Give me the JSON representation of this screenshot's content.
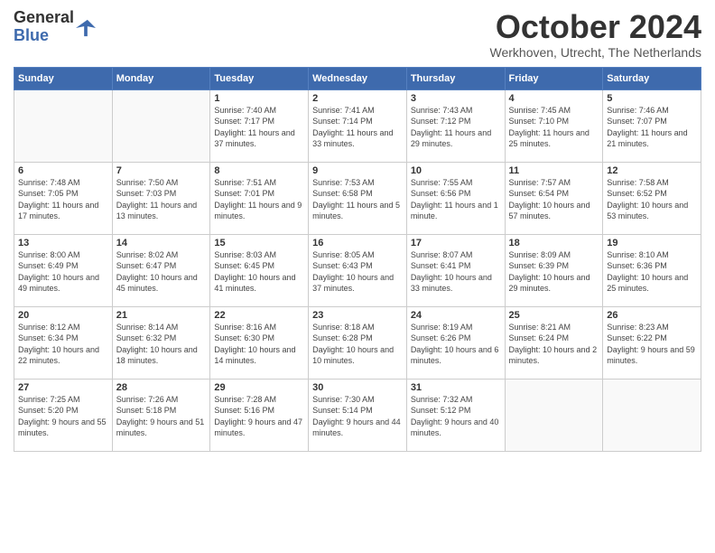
{
  "header": {
    "logo_line1": "General",
    "logo_line2": "Blue",
    "month": "October 2024",
    "location": "Werkhoven, Utrecht, The Netherlands"
  },
  "days_of_week": [
    "Sunday",
    "Monday",
    "Tuesday",
    "Wednesday",
    "Thursday",
    "Friday",
    "Saturday"
  ],
  "weeks": [
    [
      {
        "day": "",
        "sunrise": "",
        "sunset": "",
        "daylight": ""
      },
      {
        "day": "",
        "sunrise": "",
        "sunset": "",
        "daylight": ""
      },
      {
        "day": "1",
        "sunrise": "Sunrise: 7:40 AM",
        "sunset": "Sunset: 7:17 PM",
        "daylight": "Daylight: 11 hours and 37 minutes."
      },
      {
        "day": "2",
        "sunrise": "Sunrise: 7:41 AM",
        "sunset": "Sunset: 7:14 PM",
        "daylight": "Daylight: 11 hours and 33 minutes."
      },
      {
        "day": "3",
        "sunrise": "Sunrise: 7:43 AM",
        "sunset": "Sunset: 7:12 PM",
        "daylight": "Daylight: 11 hours and 29 minutes."
      },
      {
        "day": "4",
        "sunrise": "Sunrise: 7:45 AM",
        "sunset": "Sunset: 7:10 PM",
        "daylight": "Daylight: 11 hours and 25 minutes."
      },
      {
        "day": "5",
        "sunrise": "Sunrise: 7:46 AM",
        "sunset": "Sunset: 7:07 PM",
        "daylight": "Daylight: 11 hours and 21 minutes."
      }
    ],
    [
      {
        "day": "6",
        "sunrise": "Sunrise: 7:48 AM",
        "sunset": "Sunset: 7:05 PM",
        "daylight": "Daylight: 11 hours and 17 minutes."
      },
      {
        "day": "7",
        "sunrise": "Sunrise: 7:50 AM",
        "sunset": "Sunset: 7:03 PM",
        "daylight": "Daylight: 11 hours and 13 minutes."
      },
      {
        "day": "8",
        "sunrise": "Sunrise: 7:51 AM",
        "sunset": "Sunset: 7:01 PM",
        "daylight": "Daylight: 11 hours and 9 minutes."
      },
      {
        "day": "9",
        "sunrise": "Sunrise: 7:53 AM",
        "sunset": "Sunset: 6:58 PM",
        "daylight": "Daylight: 11 hours and 5 minutes."
      },
      {
        "day": "10",
        "sunrise": "Sunrise: 7:55 AM",
        "sunset": "Sunset: 6:56 PM",
        "daylight": "Daylight: 11 hours and 1 minute."
      },
      {
        "day": "11",
        "sunrise": "Sunrise: 7:57 AM",
        "sunset": "Sunset: 6:54 PM",
        "daylight": "Daylight: 10 hours and 57 minutes."
      },
      {
        "day": "12",
        "sunrise": "Sunrise: 7:58 AM",
        "sunset": "Sunset: 6:52 PM",
        "daylight": "Daylight: 10 hours and 53 minutes."
      }
    ],
    [
      {
        "day": "13",
        "sunrise": "Sunrise: 8:00 AM",
        "sunset": "Sunset: 6:49 PM",
        "daylight": "Daylight: 10 hours and 49 minutes."
      },
      {
        "day": "14",
        "sunrise": "Sunrise: 8:02 AM",
        "sunset": "Sunset: 6:47 PM",
        "daylight": "Daylight: 10 hours and 45 minutes."
      },
      {
        "day": "15",
        "sunrise": "Sunrise: 8:03 AM",
        "sunset": "Sunset: 6:45 PM",
        "daylight": "Daylight: 10 hours and 41 minutes."
      },
      {
        "day": "16",
        "sunrise": "Sunrise: 8:05 AM",
        "sunset": "Sunset: 6:43 PM",
        "daylight": "Daylight: 10 hours and 37 minutes."
      },
      {
        "day": "17",
        "sunrise": "Sunrise: 8:07 AM",
        "sunset": "Sunset: 6:41 PM",
        "daylight": "Daylight: 10 hours and 33 minutes."
      },
      {
        "day": "18",
        "sunrise": "Sunrise: 8:09 AM",
        "sunset": "Sunset: 6:39 PM",
        "daylight": "Daylight: 10 hours and 29 minutes."
      },
      {
        "day": "19",
        "sunrise": "Sunrise: 8:10 AM",
        "sunset": "Sunset: 6:36 PM",
        "daylight": "Daylight: 10 hours and 25 minutes."
      }
    ],
    [
      {
        "day": "20",
        "sunrise": "Sunrise: 8:12 AM",
        "sunset": "Sunset: 6:34 PM",
        "daylight": "Daylight: 10 hours and 22 minutes."
      },
      {
        "day": "21",
        "sunrise": "Sunrise: 8:14 AM",
        "sunset": "Sunset: 6:32 PM",
        "daylight": "Daylight: 10 hours and 18 minutes."
      },
      {
        "day": "22",
        "sunrise": "Sunrise: 8:16 AM",
        "sunset": "Sunset: 6:30 PM",
        "daylight": "Daylight: 10 hours and 14 minutes."
      },
      {
        "day": "23",
        "sunrise": "Sunrise: 8:18 AM",
        "sunset": "Sunset: 6:28 PM",
        "daylight": "Daylight: 10 hours and 10 minutes."
      },
      {
        "day": "24",
        "sunrise": "Sunrise: 8:19 AM",
        "sunset": "Sunset: 6:26 PM",
        "daylight": "Daylight: 10 hours and 6 minutes."
      },
      {
        "day": "25",
        "sunrise": "Sunrise: 8:21 AM",
        "sunset": "Sunset: 6:24 PM",
        "daylight": "Daylight: 10 hours and 2 minutes."
      },
      {
        "day": "26",
        "sunrise": "Sunrise: 8:23 AM",
        "sunset": "Sunset: 6:22 PM",
        "daylight": "Daylight: 9 hours and 59 minutes."
      }
    ],
    [
      {
        "day": "27",
        "sunrise": "Sunrise: 7:25 AM",
        "sunset": "Sunset: 5:20 PM",
        "daylight": "Daylight: 9 hours and 55 minutes."
      },
      {
        "day": "28",
        "sunrise": "Sunrise: 7:26 AM",
        "sunset": "Sunset: 5:18 PM",
        "daylight": "Daylight: 9 hours and 51 minutes."
      },
      {
        "day": "29",
        "sunrise": "Sunrise: 7:28 AM",
        "sunset": "Sunset: 5:16 PM",
        "daylight": "Daylight: 9 hours and 47 minutes."
      },
      {
        "day": "30",
        "sunrise": "Sunrise: 7:30 AM",
        "sunset": "Sunset: 5:14 PM",
        "daylight": "Daylight: 9 hours and 44 minutes."
      },
      {
        "day": "31",
        "sunrise": "Sunrise: 7:32 AM",
        "sunset": "Sunset: 5:12 PM",
        "daylight": "Daylight: 9 hours and 40 minutes."
      },
      {
        "day": "",
        "sunrise": "",
        "sunset": "",
        "daylight": ""
      },
      {
        "day": "",
        "sunrise": "",
        "sunset": "",
        "daylight": ""
      }
    ]
  ]
}
